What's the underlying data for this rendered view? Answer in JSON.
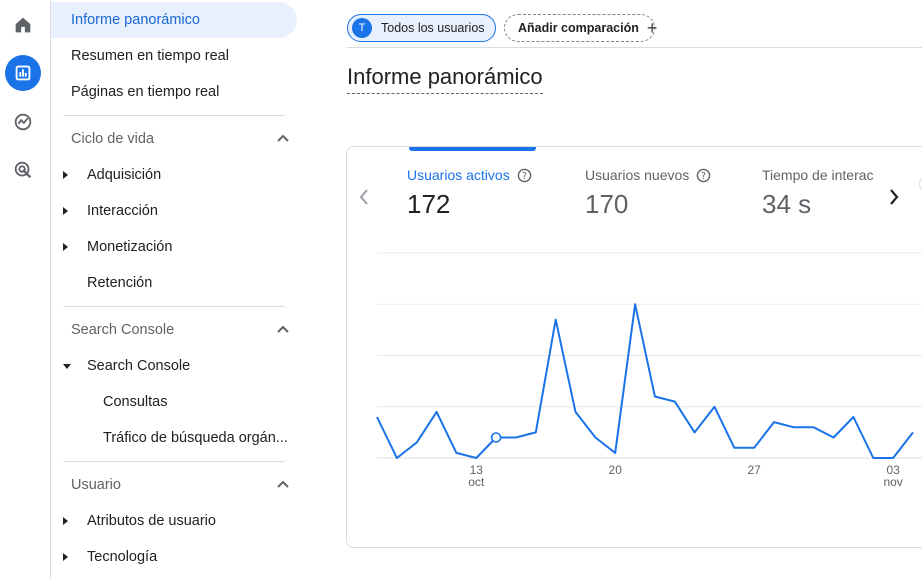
{
  "rail": {
    "items": [
      {
        "icon": "home-icon"
      },
      {
        "icon": "reports-icon",
        "active": true
      },
      {
        "icon": "explore-icon"
      },
      {
        "icon": "advertising-icon"
      }
    ]
  },
  "nav": {
    "top_items": [
      "Informe panorámico",
      "Resumen en tiempo real",
      "Páginas en tiempo real"
    ],
    "sections": [
      {
        "title": "Ciclo de vida",
        "items": [
          "Adquisición",
          "Interacción",
          "Monetización",
          "Retención"
        ]
      },
      {
        "title": "Search Console",
        "group": "Search Console",
        "subitems": [
          "Consultas",
          "Tráfico de búsqueda orgán..."
        ]
      },
      {
        "title": "Usuario",
        "items": [
          "Atributos de usuario",
          "Tecnología"
        ]
      }
    ]
  },
  "chips": {
    "users_avatar": "T",
    "users_label": "Todos los usuarios",
    "compare_label": "Añadir comparación",
    "compare_plus": "+"
  },
  "page_title": "Informe panorámico",
  "metrics": [
    {
      "label": "Usuarios activos",
      "value": "172",
      "active": true
    },
    {
      "label": "Usuarios nuevos",
      "value": "170"
    },
    {
      "label": "Tiempo de interac",
      "value": "34 s"
    }
  ],
  "colors": {
    "accent": "#1a73e8",
    "selected_bg": "#e8f0fe"
  },
  "chart_data": {
    "type": "line",
    "series": [
      {
        "values": [
          8,
          0,
          3,
          9,
          1,
          0,
          4,
          4,
          5,
          27,
          9,
          4,
          1,
          30,
          12,
          11,
          5,
          10,
          2,
          2,
          7,
          6,
          6,
          4,
          8,
          0,
          0,
          5
        ]
      }
    ],
    "x_tick_labels": [
      {
        "index": 5,
        "day": "13",
        "month": "oct"
      },
      {
        "index": 12,
        "day": "20",
        "month": ""
      },
      {
        "index": 19,
        "day": "27",
        "month": ""
      },
      {
        "index": 26,
        "day": "03",
        "month": "nov"
      }
    ],
    "highlight_index": 6,
    "ylim": [
      0,
      40
    ],
    "grid": true
  }
}
